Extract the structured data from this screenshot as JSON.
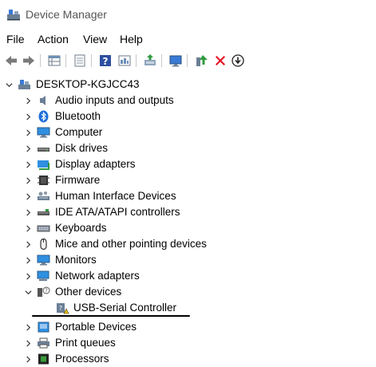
{
  "window": {
    "title": "Device Manager",
    "icon": "device-manager-icon"
  },
  "menu": [
    {
      "label": "File"
    },
    {
      "label": "Action"
    },
    {
      "label": "View"
    },
    {
      "label": "Help"
    }
  ],
  "toolbar": {
    "buttons": [
      "back-arrow-icon",
      "forward-arrow-icon",
      "properties-grid-icon",
      "show-hidden-icon",
      "help-icon",
      "view-resources-icon",
      "update-driver-icon",
      "monitor-icon",
      "add-driver-icon",
      "uninstall-x-icon",
      "scan-changes-icon"
    ],
    "colors": {
      "uninstall": "#e81123",
      "update": "#2e9a3e",
      "help": "#2d4fa0"
    }
  },
  "tree": {
    "root": {
      "label": "DESKTOP-KGJCC43",
      "expanded": true
    },
    "categories": [
      {
        "label": "Audio inputs and outputs",
        "expanded": false
      },
      {
        "label": "Bluetooth",
        "expanded": false
      },
      {
        "label": "Computer",
        "expanded": false
      },
      {
        "label": "Disk drives",
        "expanded": false
      },
      {
        "label": "Display adapters",
        "expanded": false
      },
      {
        "label": "Firmware",
        "expanded": false
      },
      {
        "label": "Human Interface Devices",
        "expanded": false
      },
      {
        "label": "IDE ATA/ATAPI controllers",
        "expanded": false
      },
      {
        "label": "Keyboards",
        "expanded": false
      },
      {
        "label": "Mice and other pointing devices",
        "expanded": false
      },
      {
        "label": "Monitors",
        "expanded": false
      },
      {
        "label": "Network adapters",
        "expanded": false
      },
      {
        "label": "Other devices",
        "expanded": true,
        "children": [
          {
            "label": "USB-Serial Controller",
            "warning": true
          }
        ]
      },
      {
        "label": "Portable Devices",
        "expanded": false
      },
      {
        "label": "Print queues",
        "expanded": false
      },
      {
        "label": "Processors",
        "expanded": false
      }
    ]
  }
}
